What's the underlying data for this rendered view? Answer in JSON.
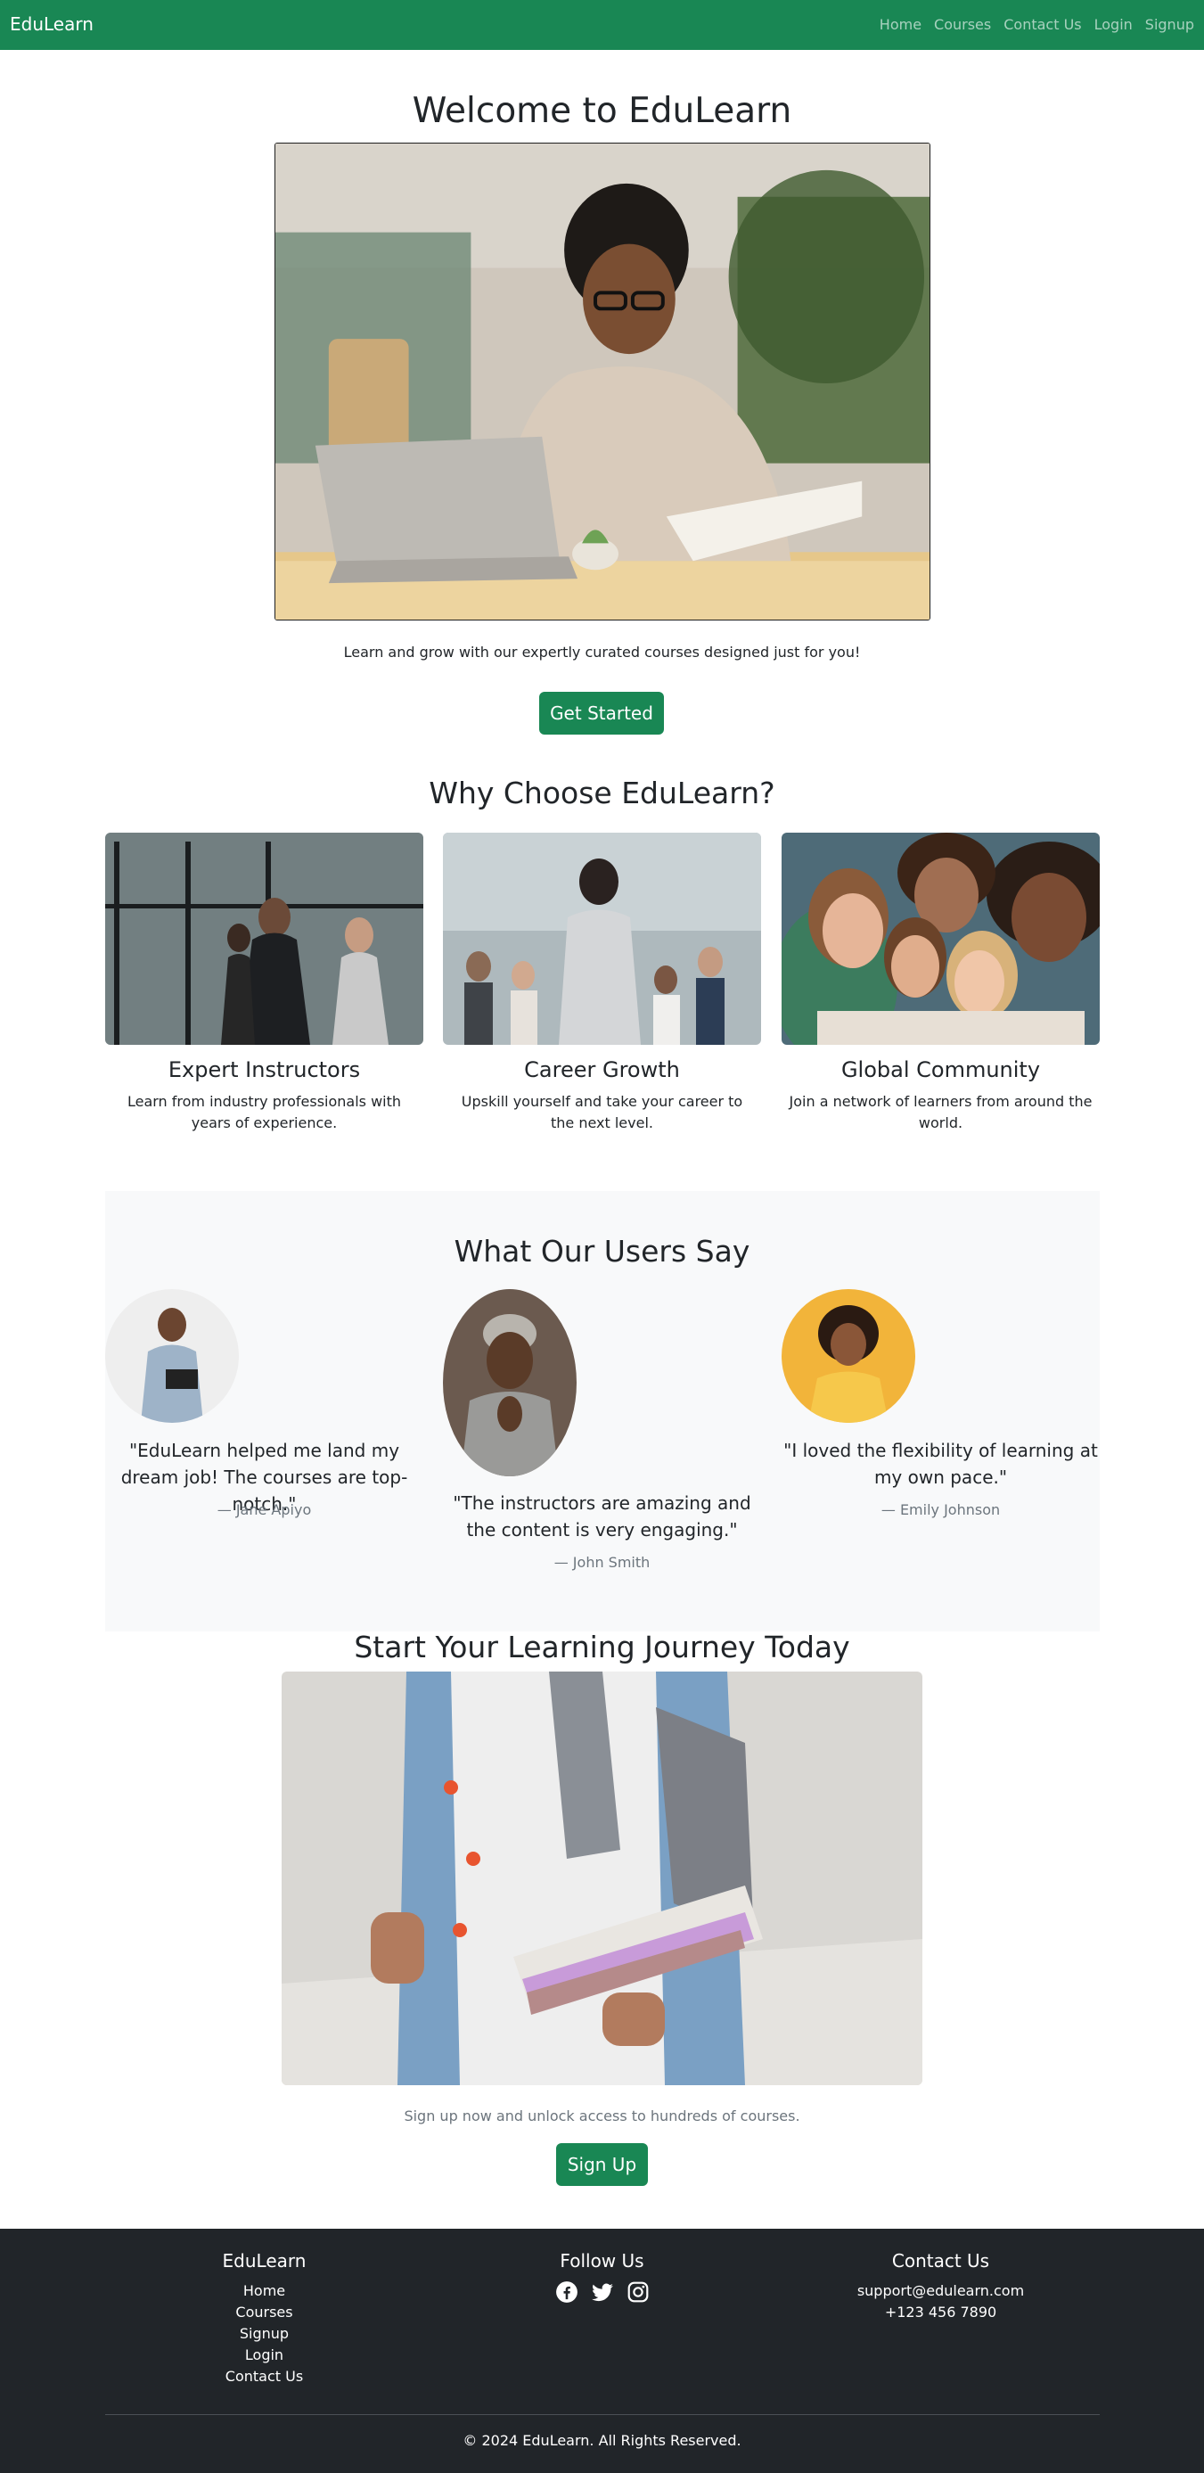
{
  "navbar": {
    "brand": "EduLearn",
    "links": [
      "Home",
      "Courses",
      "Contact Us",
      "Login",
      "Signup"
    ]
  },
  "hero": {
    "title": "Welcome to EduLearn",
    "subtitle": "Learn and grow with our expertly curated courses designed just for you!",
    "button": "Get Started"
  },
  "why": {
    "title": "Why Choose EduLearn?",
    "features": [
      {
        "title": "Expert Instructors",
        "desc": "Learn from industry professionals with years of experience."
      },
      {
        "title": "Career Growth",
        "desc": "Upskill yourself and take your career to the next level."
      },
      {
        "title": "Global Community",
        "desc": "Join a network of learners from around the world."
      }
    ]
  },
  "testimonials": {
    "title": "What Our Users Say",
    "items": [
      {
        "quote": "\"EduLearn helped me land my dream job! The courses are top-notch.\"",
        "author": "— Jane Apiyo"
      },
      {
        "quote": "\"The instructors are amazing and the content is very engaging.\"",
        "author": "— John Smith"
      },
      {
        "quote": "\"I loved the flexibility of learning at my own pace.\"",
        "author": "— Emily Johnson"
      }
    ]
  },
  "journey": {
    "title": "Start Your Learning Journey Today",
    "subtitle": "Sign up now and unlock access to hundreds of courses.",
    "button": "Sign Up"
  },
  "footer": {
    "brand_title": "EduLearn",
    "links": [
      "Home",
      "Courses",
      "Signup",
      "Login",
      "Contact Us"
    ],
    "follow_title": "Follow Us",
    "social_icons": [
      "facebook-icon",
      "twitter-icon",
      "instagram-icon"
    ],
    "contact_title": "Contact Us",
    "email": "support@edulearn.com",
    "phone": "+123 456 7890",
    "copyright": "© 2024 EduLearn. All Rights Reserved."
  },
  "colors": {
    "primary_green": "#198754",
    "footer_dark": "#212529",
    "section_gray": "#f8f9fa"
  }
}
